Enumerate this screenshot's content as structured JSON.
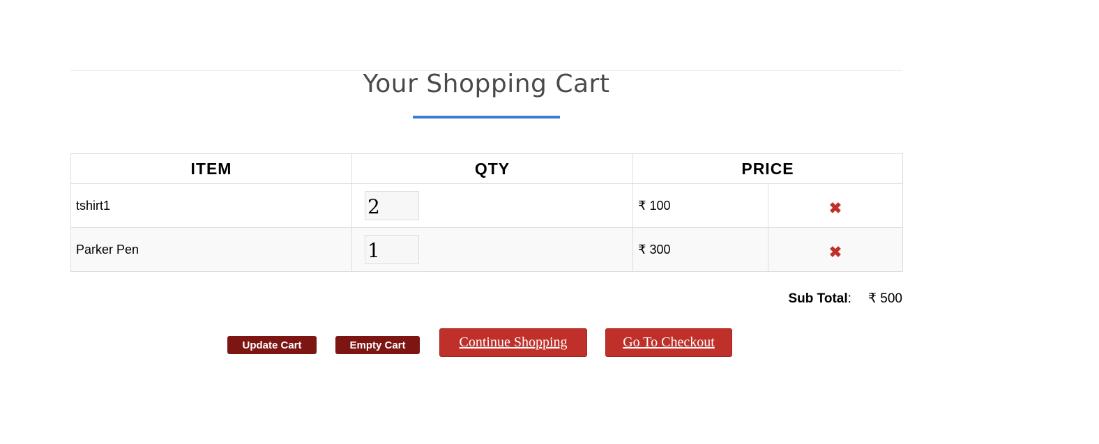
{
  "page": {
    "title": "Your Shopping Cart"
  },
  "table": {
    "headers": [
      "ITEM",
      "QTY",
      "PRICE"
    ],
    "rows": [
      {
        "item": "tshirt1",
        "qty": "2",
        "price": "₹ 100",
        "remove_icon": "close-x-icon"
      },
      {
        "item": "Parker Pen",
        "qty": "1",
        "price": "₹ 300",
        "remove_icon": "close-x-icon"
      }
    ]
  },
  "summary": {
    "subtotal_label": "Sub Total",
    "subtotal_colon": ":",
    "subtotal_value": "₹ 500"
  },
  "actions": {
    "update_cart": "Update Cart",
    "empty_cart": "Empty Cart",
    "continue_shopping": "Continue Shopping",
    "go_to_checkout": "Go To Checkout"
  },
  "colors": {
    "accent_blue": "#3a7bd5",
    "button_dark_red": "#7d1612",
    "button_red": "#c0302a",
    "remove_red": "#c0302a"
  }
}
